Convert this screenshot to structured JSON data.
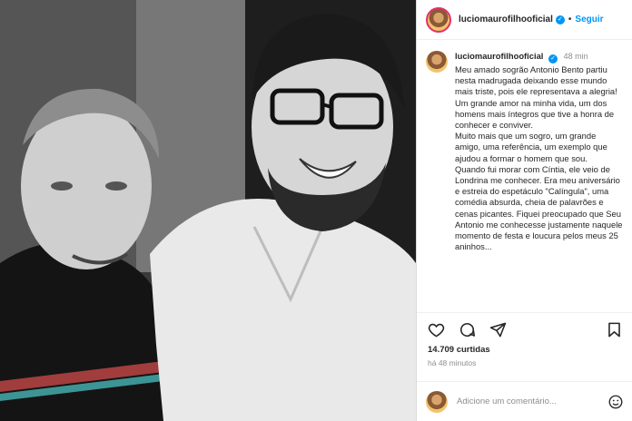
{
  "post": {
    "username": "luciomaurofilhooficial",
    "follow_label": "Seguir",
    "separator": "•",
    "time_short": "48 min",
    "caption": [
      "Meu amado sogrão Antonio Bento partiu nesta madrugada deixando esse mundo mais triste, pois ele representava a alegria!",
      "Um grande amor na minha vida, um dos homens mais íntegros que tive a honra de conhecer e conviver.",
      "Muito mais que um sogro, um grande amigo, uma referência, um exemplo que ajudou a formar o homem que sou.",
      "Quando fui morar com Cíntia, ele veio de Londrina me conhecer. Era meu aniversário e estreia do espetáculo \"Calíngula\", uma comédia absurda, cheia de palavrões e cenas picantes. Fiquei preocupado que Seu Antonio me conhecesse justamente naquele momento de festa e loucura pelos meus 25 aninhos..."
    ],
    "likes": "14.709 curtidas",
    "time_ago": "há 48 minutos",
    "comment_placeholder": "Adicione um comentário..."
  },
  "icons": {
    "verified": "verified-badge-icon",
    "like": "heart-icon",
    "comment": "comment-bubble-icon",
    "share": "paper-plane-icon",
    "save": "bookmark-icon",
    "emoji": "smiley-icon"
  },
  "colors": {
    "link_blue": "#0095f6",
    "text": "#262626",
    "muted": "#8e8e8e",
    "divider": "#efefef"
  }
}
